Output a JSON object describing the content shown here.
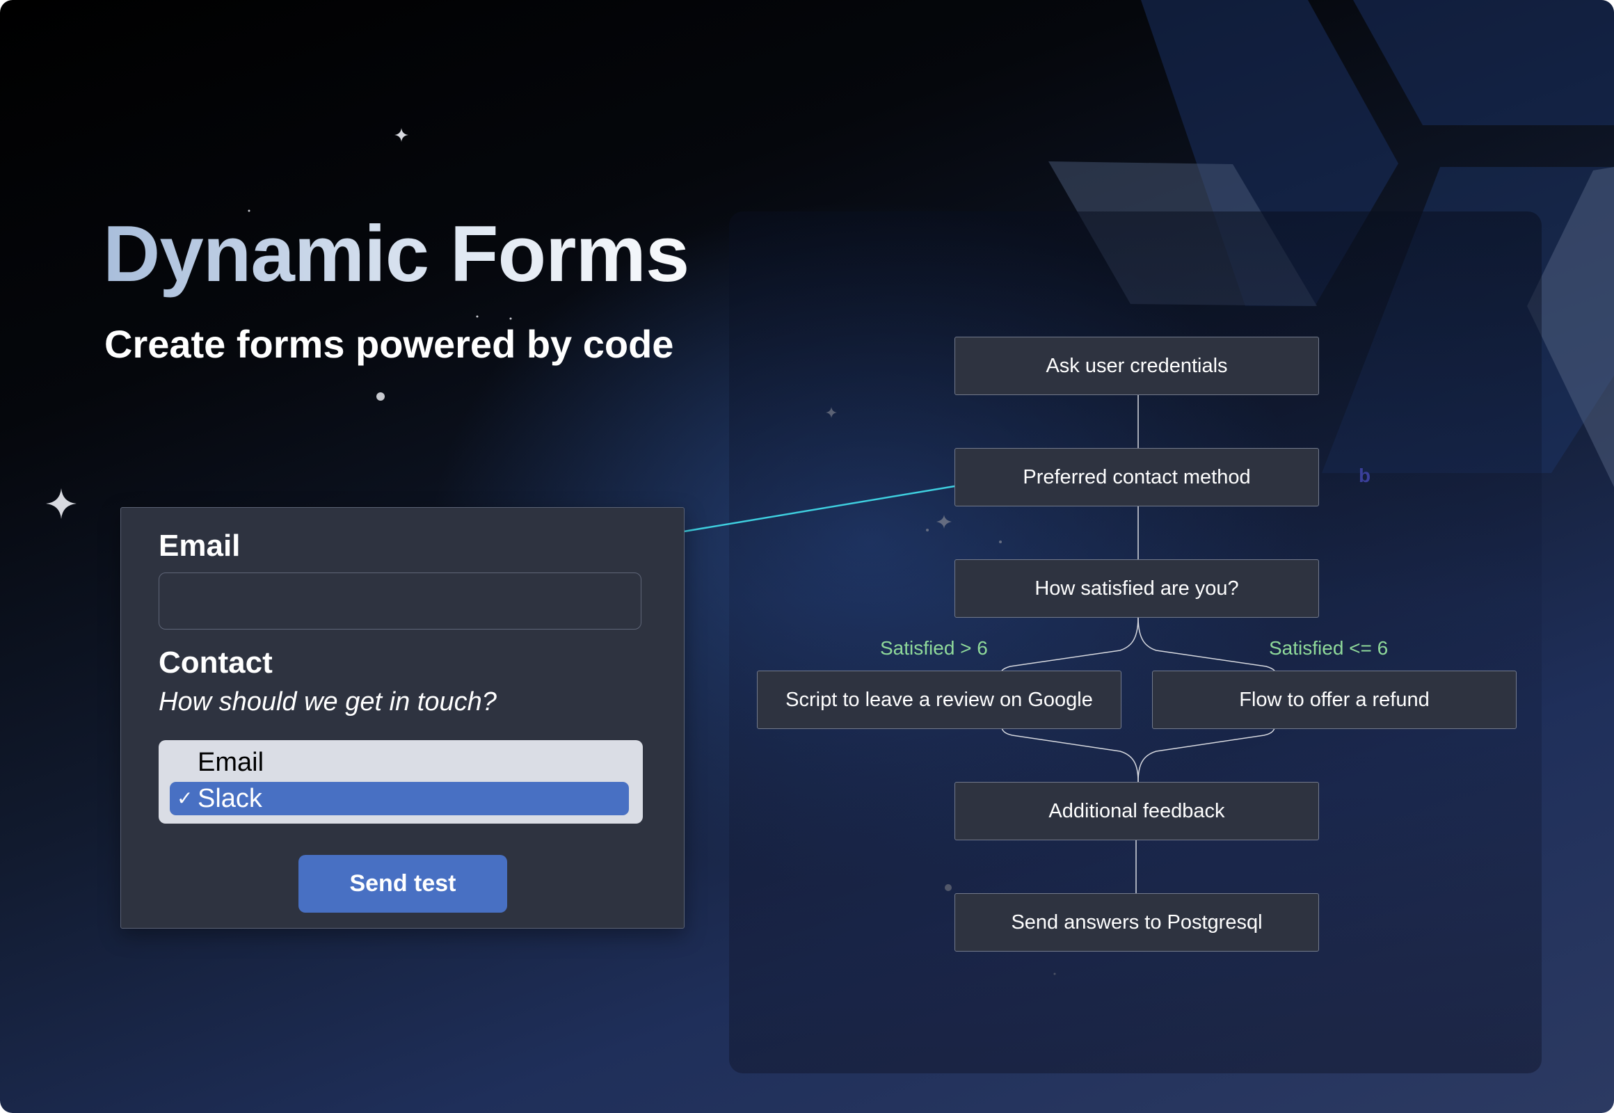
{
  "hero": {
    "title": "Dynamic Forms",
    "subtitle": "Create forms powered by code"
  },
  "form": {
    "email_label": "Email",
    "email_value": "",
    "email_placeholder": "",
    "contact_label": "Contact",
    "contact_hint": "How should we get in touch?",
    "contact_options": [
      "Email",
      "Slack"
    ],
    "contact_selected": "Slack",
    "check_glyph": "✓",
    "send_button": "Send test"
  },
  "flow": {
    "nodes": [
      "Ask user credentials",
      "Preferred contact method",
      "How satisfied are you?",
      "Script to leave a review on Google",
      "Flow to offer a refund",
      "Additional feedback",
      "Send answers to Postgresql"
    ],
    "branch_labels": [
      "Satisfied > 6",
      "Satisfied <= 6"
    ],
    "stray_letter": "b"
  },
  "colors": {
    "accent": "#4870c3",
    "connector": "#3fd0e0",
    "branch_label": "#8fd99a",
    "node_bg": "#2e3340",
    "node_border": "#737a8c"
  }
}
